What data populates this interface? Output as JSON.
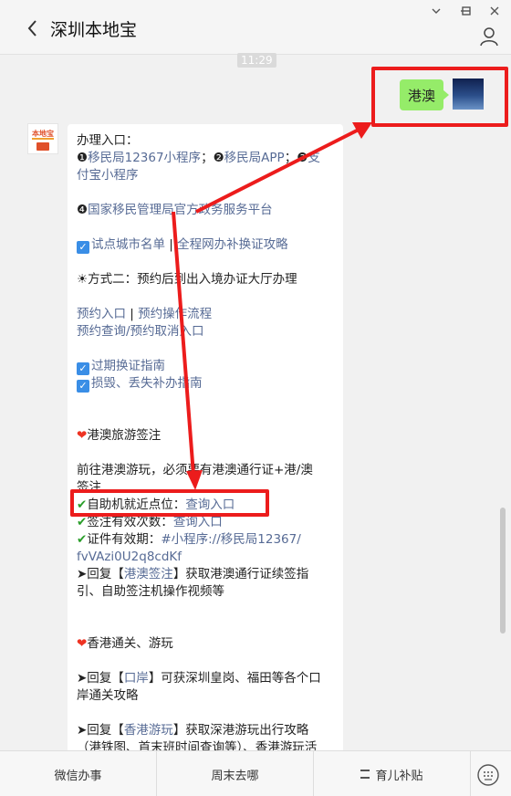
{
  "header": {
    "title": "深圳本地宝"
  },
  "chat": {
    "timestamp": "11:29",
    "outgoing": {
      "text": "港澳"
    },
    "account_avatar": {
      "text": "本地宝"
    },
    "message": {
      "l1": "办理入口：",
      "l2_n1": "❶",
      "l2_a": "移民局12367小程序",
      "l2_s1": "；",
      "l2_n2": "❷",
      "l2_b": "移民局APP",
      "l2_s2": "；",
      "l2_n3": "❸",
      "l2_c": "支",
      "l3": "付宝小程序",
      "l4_n": "❹",
      "l4": "国家移民管理局官方政务服务平台",
      "l5_a": "试点城市名单",
      "l5_sep": " | ",
      "l5_b": "全程网办补换证攻略",
      "l6": "☀方式二：预约后到出入境办证大厅办理",
      "l7_a": "预约入口",
      "l7_sep": " | ",
      "l7_b": "预约操作流程",
      "l8": "预约查询/预约取消入口",
      "l9": "过期换证指南",
      "l10": "损毁、丢失补办指南",
      "sec2": "港澳旅游签注",
      "p1": "前往港澳游玩，必须要有港澳通行证+港/澳",
      "p2": "签注",
      "c1_label": "自助机就近点位：",
      "c1_link": "查询入口",
      "c2_label": "签注有效次数：",
      "c2_link": "查询入口",
      "c3_label": "证件有效期：",
      "c3_link1": "#小程序://移民局12367/",
      "c3_link2": "fvVAzi0U2q8cdKf",
      "r1_a": "➤回复【",
      "r1_kw": "港澳签注",
      "r1_b": "】获取港澳通行证续签指",
      "r1_c": "引、自助签注机操作视频等",
      "sec3": "香港通关、游玩",
      "r2_a": "➤回复【",
      "r2_kw": "口岸",
      "r2_b": "】可获深圳皇岗、福田等各个口",
      "r2_c": "岸通关攻略",
      "r3_a": "➤回复【",
      "r3_kw": "香港游玩",
      "r3_b": "】获取深港游玩出行攻略",
      "r3_c": "（港铁图、首末班时间查询等）、香港游玩活"
    }
  },
  "bottom_menu": [
    {
      "label": "微信办事"
    },
    {
      "label": "周末去哪"
    },
    {
      "label": "育儿补贴"
    }
  ]
}
